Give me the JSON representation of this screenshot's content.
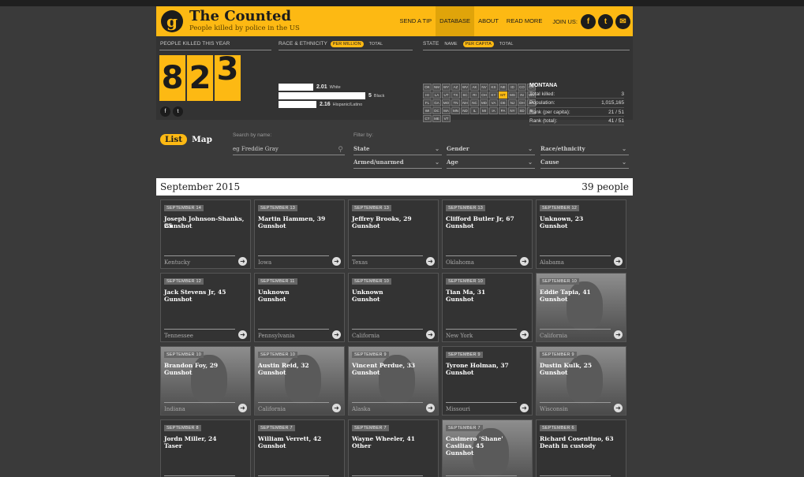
{
  "header": {
    "logo_glyph": "g",
    "title": "The Counted",
    "subtitle": "People killed by police in the US",
    "nav": [
      "SEND A TIP",
      "DATABASE",
      "ABOUT",
      "READ MORE"
    ],
    "join_label": "JOIN US:",
    "social": [
      {
        "icon": "facebook-icon",
        "glyph": "f"
      },
      {
        "icon": "twitter-icon",
        "glyph": "t"
      },
      {
        "icon": "email-icon",
        "glyph": "✉"
      }
    ]
  },
  "stats": {
    "killed_label": "PEOPLE KILLED THIS YEAR",
    "digits": [
      "8",
      "2",
      "3"
    ],
    "race_label": "RACE & ETHNICITY",
    "race_toggles": [
      "PER MILLION",
      "TOTAL"
    ],
    "race_rows": [
      {
        "value": "2.01",
        "name": "White"
      },
      {
        "value": "5",
        "name": "Black"
      },
      {
        "value": "2.16",
        "name": "Hispanic/Latino"
      }
    ],
    "state_label": "STATE",
    "state_toggles": [
      "NAME",
      "PER CAPITA",
      "TOTAL"
    ],
    "states": [
      "OK",
      "NM",
      "WY",
      "AZ",
      "WV",
      "AK",
      "NV",
      "KS",
      "NE",
      "ID",
      "CO",
      "CA",
      "HI",
      "LA",
      "UT",
      "TX",
      "SC",
      "RI",
      "OH",
      "KY",
      "MT",
      "MS",
      "IN",
      "WA",
      "FL",
      "GA",
      "MO",
      "TN",
      "NH",
      "NC",
      "MD",
      "VA",
      "DE",
      "NJ",
      "DH",
      "AR",
      "WI",
      "DC",
      "MA",
      "MN",
      "ND",
      "IL",
      "MI",
      "IA",
      "PA",
      "NY",
      "SD",
      "RI",
      "CT",
      "ME",
      "VT"
    ],
    "selected_state": "MT",
    "state_info": {
      "name": "MONTANA",
      "rows": [
        {
          "label": "Total killed:",
          "value": "3"
        },
        {
          "label": "Population:",
          "value": "1,015,165"
        },
        {
          "label": "Rank (per capita):",
          "value": "21 / 51"
        },
        {
          "label": "Rank (total):",
          "value": "41 / 51"
        }
      ]
    }
  },
  "filters": {
    "view_toggle": [
      "List",
      "Map"
    ],
    "search_label": "Search by name:",
    "search_placeholder": "eg Freddie Gray",
    "filter_label": "Filter by:",
    "dropdowns": [
      "State",
      "Gender",
      "Race/ethnicity",
      "Armed/unarmed",
      "Age",
      "Cause"
    ]
  },
  "month": {
    "label": "September 2015",
    "count": "39 people"
  },
  "cards": [
    {
      "date": "SEPTEMBER 14",
      "name": "Joseph Johnson-Shanks, 25",
      "cause": "Gunshot",
      "state": "Kentucky",
      "photo": false
    },
    {
      "date": "SEPTEMBER 13",
      "name": "Martin Hammen, 39",
      "cause": "Gunshot",
      "state": "Iowa",
      "photo": false
    },
    {
      "date": "SEPTEMBER 13",
      "name": "Jeffrey Brooks, 29",
      "cause": "Gunshot",
      "state": "Texas",
      "photo": false
    },
    {
      "date": "SEPTEMBER 13",
      "name": "Clifford Butler Jr, 67",
      "cause": "Gunshot",
      "state": "Oklahoma",
      "photo": false
    },
    {
      "date": "SEPTEMBER 12",
      "name": "Unknown, 23",
      "cause": "Gunshot",
      "state": "Alabama",
      "photo": false
    },
    {
      "date": "SEPTEMBER 12",
      "name": "Jack Stevens Jr, 45",
      "cause": "Gunshot",
      "state": "Tennessee",
      "photo": false
    },
    {
      "date": "SEPTEMBER 11",
      "name": "Unknown",
      "cause": "Gunshot",
      "state": "Pennsylvania",
      "photo": false
    },
    {
      "date": "SEPTEMBER 10",
      "name": "Unknown",
      "cause": "Gunshot",
      "state": "California",
      "photo": false
    },
    {
      "date": "SEPTEMBER 10",
      "name": "Tian Ma, 31",
      "cause": "Gunshot",
      "state": "New York",
      "photo": false
    },
    {
      "date": "SEPTEMBER 10",
      "name": "Eddie Tapia, 41",
      "cause": "Gunshot",
      "state": "California",
      "photo": true
    },
    {
      "date": "SEPTEMBER 10",
      "name": "Brandon Foy, 29",
      "cause": "Gunshot",
      "state": "Indiana",
      "photo": true
    },
    {
      "date": "SEPTEMBER 10",
      "name": "Austin Reid, 32",
      "cause": "Gunshot",
      "state": "California",
      "photo": true
    },
    {
      "date": "SEPTEMBER 9",
      "name": "Vincent Perdue, 33",
      "cause": "Gunshot",
      "state": "Alaska",
      "photo": true
    },
    {
      "date": "SEPTEMBER 9",
      "name": "Tyrone Holman, 37",
      "cause": "Gunshot",
      "state": "Missouri",
      "photo": false
    },
    {
      "date": "SEPTEMBER 9",
      "name": "Dustin Kulk, 25",
      "cause": "Gunshot",
      "state": "Wisconsin",
      "photo": true
    },
    {
      "date": "SEPTEMBER 8",
      "name": "Jordn Miller, 24",
      "cause": "Taser",
      "state": "",
      "photo": false
    },
    {
      "date": "SEPTEMBER 7",
      "name": "William Verrett, 42",
      "cause": "Gunshot",
      "state": "",
      "photo": false
    },
    {
      "date": "SEPTEMBER 7",
      "name": "Wayne Wheeler, 41",
      "cause": "Other",
      "state": "",
      "photo": false
    },
    {
      "date": "SEPTEMBER 7",
      "name": "Casimero 'Shane' Casilias, 45",
      "cause": "Gunshot",
      "state": "",
      "photo": true
    },
    {
      "date": "SEPTEMBER 6",
      "name": "Richard Cosentino, 63",
      "cause": "Death in custody",
      "state": "",
      "photo": false
    }
  ]
}
